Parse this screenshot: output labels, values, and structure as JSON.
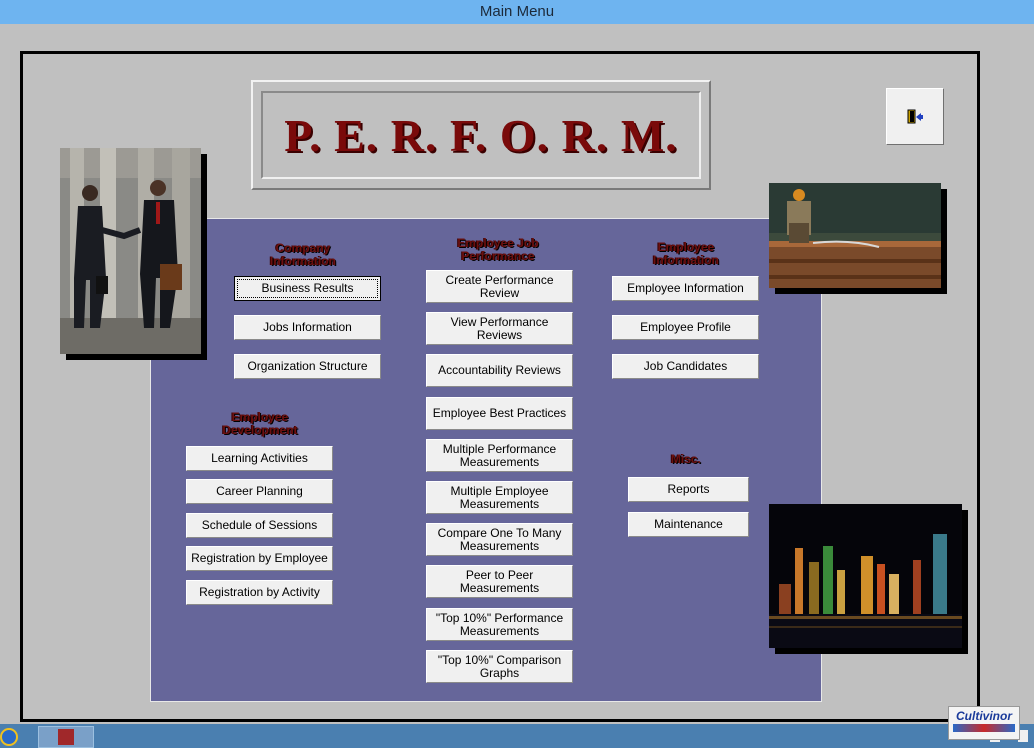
{
  "window": {
    "title": "Main Menu"
  },
  "banner": {
    "title": "P. E. R. F. O. R. M."
  },
  "exit_button": {
    "icon": "exit-door-icon"
  },
  "sections": {
    "company": {
      "header": "Company\nInformation",
      "buttons": [
        "Business Results",
        "Jobs Information",
        "Organization Structure"
      ]
    },
    "job_performance": {
      "header": "Employee Job\nPerformance",
      "buttons": [
        "Create Performance Review",
        "View Performance Reviews",
        "Accountability Reviews",
        "Employee Best Practices",
        "Multiple Performance\nMeasurements",
        "Multiple Employee\nMeasurements",
        "Compare One To Many\nMeasurements",
        "Peer to Peer\nMeasurements",
        "\"Top 10%\" Performance\nMeasurements",
        "\"Top 10%\"  Comparison\nGraphs"
      ]
    },
    "employee_info": {
      "header": "Employee\nInformation",
      "buttons": [
        "Employee Information",
        "Employee Profile",
        "Job Candidates"
      ]
    },
    "development": {
      "header": "Employee\nDevelopment",
      "buttons": [
        "Learning Activities",
        "Career Planning",
        "Schedule of Sessions",
        "Registration by Employee",
        "Registration by Activity"
      ]
    },
    "misc": {
      "header": "Misc.",
      "buttons": [
        "Reports",
        "Maintenance"
      ]
    }
  },
  "logo": {
    "text": "Cultivinor"
  },
  "colors": {
    "panel": "#66669a",
    "header_text": "#6b1010",
    "banner_text": "#7a0a0a"
  }
}
